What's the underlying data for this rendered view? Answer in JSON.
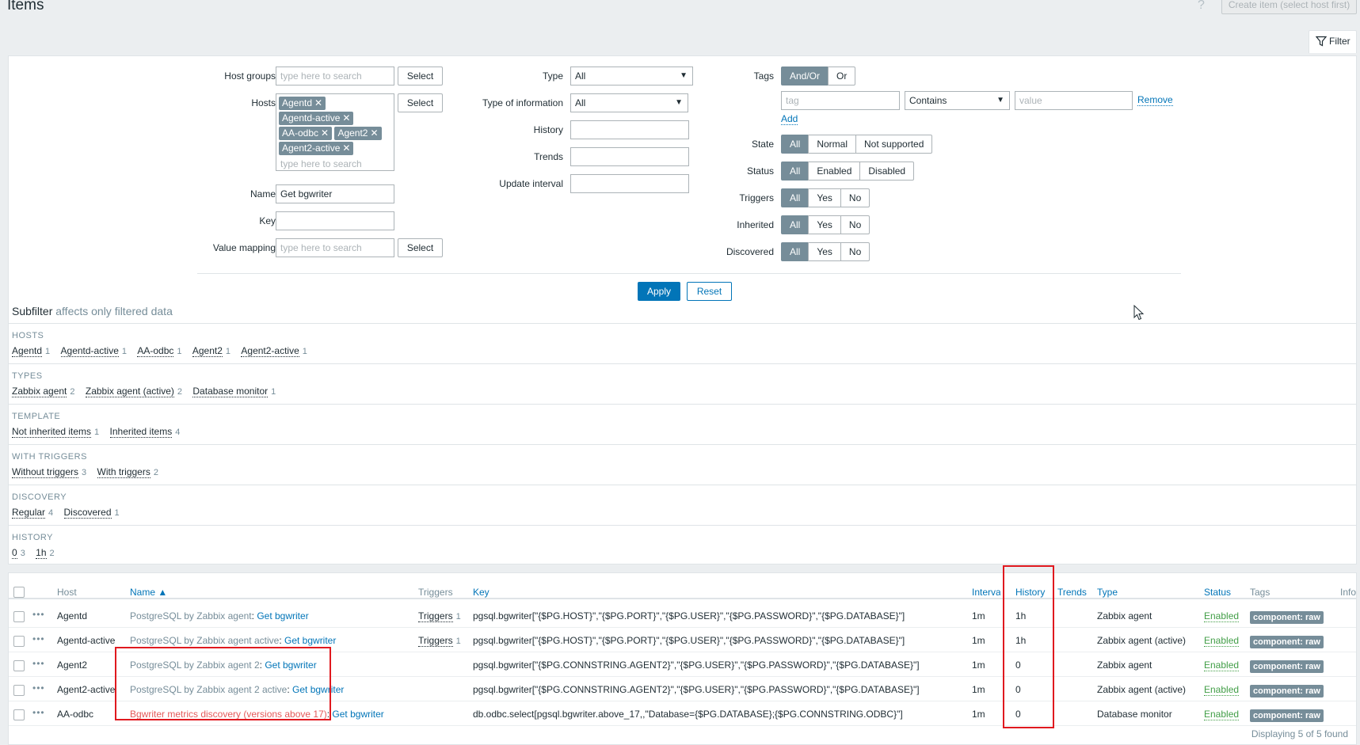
{
  "header": {
    "title": "Items",
    "help_icon": "?",
    "create_button": "Create item (select host first)"
  },
  "filter_tab": {
    "label": "Filter",
    "icon": "funnel-icon"
  },
  "filter": {
    "host_groups": {
      "label": "Host groups",
      "placeholder": "type here to search",
      "select": "Select"
    },
    "hosts": {
      "label": "Hosts",
      "chips": [
        "Agentd",
        "Agentd-active",
        "AA-odbc",
        "Agent2",
        "Agent2-active"
      ],
      "chip_remove": "✕",
      "placeholder": "type here to search",
      "select": "Select"
    },
    "name": {
      "label": "Name",
      "value": "Get bgwriter"
    },
    "key": {
      "label": "Key",
      "value": ""
    },
    "value_mapping": {
      "label": "Value mapping",
      "placeholder": "type here to search",
      "select": "Select"
    },
    "type": {
      "label": "Type",
      "value": "All"
    },
    "type_of_information": {
      "label": "Type of information",
      "value": "All"
    },
    "history": {
      "label": "History",
      "value": ""
    },
    "trends": {
      "label": "Trends",
      "value": ""
    },
    "update_interval": {
      "label": "Update interval",
      "value": ""
    },
    "tags": {
      "label": "Tags",
      "mode_options": [
        "And/Or",
        "Or"
      ],
      "tag_placeholder": "tag",
      "operator": "Contains",
      "value_placeholder": "value",
      "remove": "Remove",
      "add": "Add"
    },
    "state": {
      "label": "State",
      "options": [
        "All",
        "Normal",
        "Not supported"
      ]
    },
    "status": {
      "label": "Status",
      "options": [
        "All",
        "Enabled",
        "Disabled"
      ]
    },
    "triggers": {
      "label": "Triggers",
      "options": [
        "All",
        "Yes",
        "No"
      ]
    },
    "inherited": {
      "label": "Inherited",
      "options": [
        "All",
        "Yes",
        "No"
      ]
    },
    "discovered": {
      "label": "Discovered",
      "options": [
        "All",
        "Yes",
        "No"
      ]
    },
    "apply": "Apply",
    "reset": "Reset"
  },
  "subfilter": {
    "title": "Subfilter",
    "subtitle": "affects only filtered data",
    "groups": [
      {
        "heading": "HOSTS",
        "items": [
          {
            "label": "Agentd",
            "count": "1"
          },
          {
            "label": "Agentd-active",
            "count": "1"
          },
          {
            "label": "AA-odbc",
            "count": "1"
          },
          {
            "label": "Agent2",
            "count": "1"
          },
          {
            "label": "Agent2-active",
            "count": "1"
          }
        ]
      },
      {
        "heading": "TYPES",
        "items": [
          {
            "label": "Zabbix agent",
            "count": "2"
          },
          {
            "label": "Zabbix agent (active)",
            "count": "2"
          },
          {
            "label": "Database monitor",
            "count": "1"
          }
        ]
      },
      {
        "heading": "TEMPLATE",
        "items": [
          {
            "label": "Not inherited items",
            "count": "1"
          },
          {
            "label": "Inherited items",
            "count": "4"
          }
        ]
      },
      {
        "heading": "WITH TRIGGERS",
        "items": [
          {
            "label": "Without triggers",
            "count": "3"
          },
          {
            "label": "With triggers",
            "count": "2"
          }
        ]
      },
      {
        "heading": "DISCOVERY",
        "items": [
          {
            "label": "Regular",
            "count": "4"
          },
          {
            "label": "Discovered",
            "count": "1"
          }
        ]
      },
      {
        "heading": "HISTORY",
        "items": [
          {
            "label": "0",
            "count": "3"
          },
          {
            "label": "1h",
            "count": "2"
          }
        ]
      }
    ]
  },
  "table": {
    "columns": {
      "host": "Host",
      "name": "Name ▲",
      "triggers": "Triggers",
      "key": "Key",
      "interval": "Interval",
      "history": "History",
      "trends": "Trends",
      "type": "Type",
      "status": "Status",
      "tags": "Tags",
      "info": "Info"
    },
    "rows": [
      {
        "host": "Agentd",
        "name_prefix": "PostgreSQL by Zabbix agent",
        "name": "Get bgwriter",
        "triggers": "Triggers",
        "trigger_count": "1",
        "key": "pgsql.bgwriter[\"{$PG.HOST}\",\"{$PG.PORT}\",\"{$PG.USER}\",\"{$PG.PASSWORD}\",\"{$PG.DATABASE}\"]",
        "interval": "1m",
        "history": "1h",
        "trends": "",
        "type": "Zabbix agent",
        "status": "Enabled",
        "tag": "component: raw"
      },
      {
        "host": "Agentd-active",
        "name_prefix": "PostgreSQL by Zabbix agent active",
        "name": "Get bgwriter",
        "triggers": "Triggers",
        "trigger_count": "1",
        "key": "pgsql.bgwriter[\"{$PG.HOST}\",\"{$PG.PORT}\",\"{$PG.USER}\",\"{$PG.PASSWORD}\",\"{$PG.DATABASE}\"]",
        "interval": "1m",
        "history": "1h",
        "trends": "",
        "type": "Zabbix agent (active)",
        "status": "Enabled",
        "tag": "component: raw"
      },
      {
        "host": "Agent2",
        "name_prefix": "PostgreSQL by Zabbix agent 2",
        "name": "Get bgwriter",
        "triggers": "",
        "trigger_count": "",
        "key": "pgsql.bgwriter[\"{$PG.CONNSTRING.AGENT2}\",\"{$PG.USER}\",\"{$PG.PASSWORD}\",\"{$PG.DATABASE}\"]",
        "interval": "1m",
        "history": "0",
        "trends": "",
        "type": "Zabbix agent",
        "status": "Enabled",
        "tag": "component: raw"
      },
      {
        "host": "Agent2-active",
        "name_prefix": "PostgreSQL by Zabbix agent 2 active",
        "name": "Get bgwriter",
        "triggers": "",
        "trigger_count": "",
        "key": "pgsql.bgwriter[\"{$PG.CONNSTRING.AGENT2}\",\"{$PG.USER}\",\"{$PG.PASSWORD}\",\"{$PG.DATABASE}\"]",
        "interval": "1m",
        "history": "0",
        "trends": "",
        "type": "Zabbix agent (active)",
        "status": "Enabled",
        "tag": "component: raw"
      },
      {
        "host": "AA-odbc",
        "name_prefix": "Bgwriter metrics discovery (versions above 17)",
        "name": "Get bgwriter",
        "triggers": "",
        "trigger_count": "",
        "key": "db.odbc.select[pgsql.bgwriter.above_17,,\"Database={$PG.DATABASE};{$PG.CONNSTRING.ODBC}\"]",
        "interval": "1m",
        "history": "0",
        "trends": "",
        "type": "Database monitor",
        "status": "Enabled",
        "tag": "component: raw"
      }
    ],
    "footer": "Displaying 5 of 5 found"
  },
  "colors": {
    "accent": "#0275b8",
    "enabled": "#429e47",
    "discovery": "#e45959",
    "highlight": "#e0191f",
    "chip": "#768d99"
  }
}
